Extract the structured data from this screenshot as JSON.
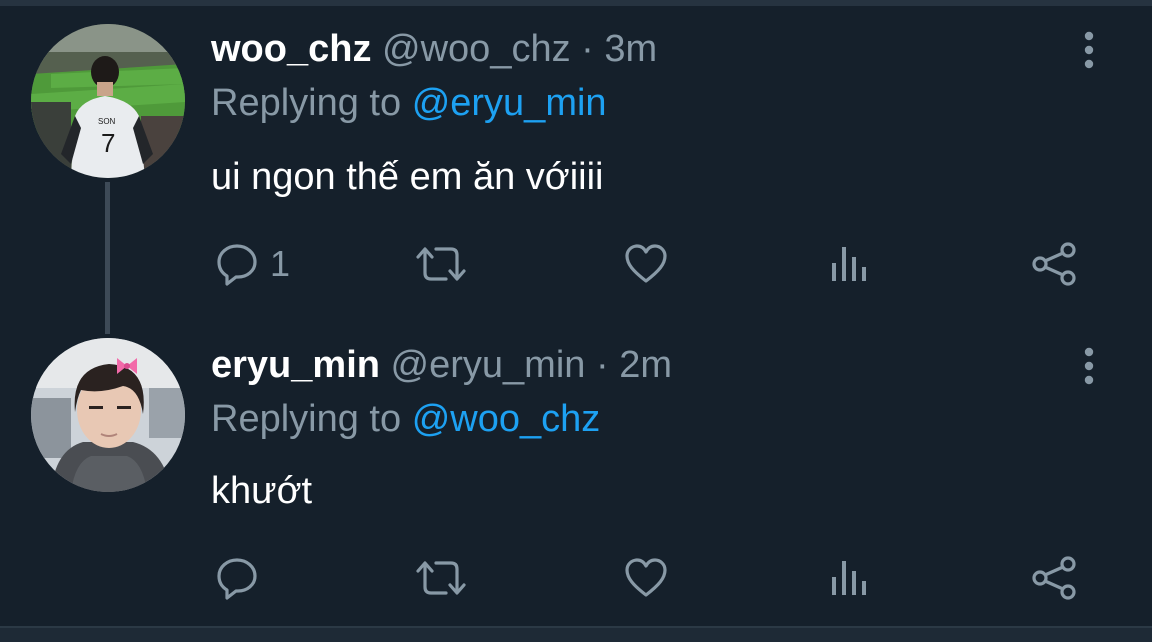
{
  "tweets": [
    {
      "name": "woo_chz",
      "handle": "@woo_chz",
      "separator": "·",
      "time": "3m",
      "replying_prefix": "Replying to",
      "replying_to": "@eryu_min",
      "text": "ui ngon thế em ăn vớiiii",
      "reply_count": "1",
      "avatar_desc": "person in SON 7 jersey at stadium"
    },
    {
      "name": "eryu_min",
      "handle": "@eryu_min",
      "separator": "·",
      "time": "2m",
      "replying_prefix": "Replying to",
      "replying_to": "@woo_chz",
      "text": "khướt",
      "reply_count": "",
      "avatar_desc": "person with pink bow hair clip"
    }
  ],
  "avatar1_jersey_text": "SON",
  "avatar1_jersey_number": "7",
  "icons": {
    "reply": "reply-icon",
    "retweet": "retweet-icon",
    "like": "heart-icon",
    "stats": "analytics-icon",
    "share": "share-icon",
    "more": "more-vertical-icon"
  },
  "colors": {
    "background": "#15202b",
    "text_primary": "#ffffff",
    "text_secondary": "#8899a6",
    "accent": "#1da1f2"
  }
}
